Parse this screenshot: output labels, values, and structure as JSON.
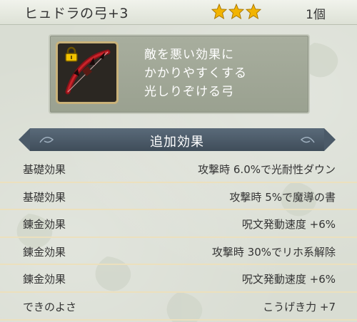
{
  "item": {
    "name": "ヒュドラの弓+3",
    "stars": 3,
    "count": "1個",
    "description": [
      "敵を悪い効果に",
      "かかりやすくする",
      "光しりぞける弓"
    ]
  },
  "section": {
    "title": "追加効果"
  },
  "effects": [
    {
      "label": "基礎効果",
      "value": "攻撃時 6.0%で光耐性ダウン"
    },
    {
      "label": "基礎効果",
      "value": "攻撃時 5%で魔導の書"
    },
    {
      "label": "錬金効果",
      "value": "呪文発動速度 +6%"
    },
    {
      "label": "錬金効果",
      "value": "攻撃時 30%でリホ系解除"
    },
    {
      "label": "錬金効果",
      "value": "呪文発動速度 +6%"
    },
    {
      "label": "できのよさ",
      "value": "こうげき力 +7"
    }
  ],
  "colors": {
    "star": "#f2b400",
    "header": "#4b5a68",
    "divider": "#ece0bd"
  },
  "icons": {
    "item": "bow-icon",
    "lock": "lock-icon",
    "star": "star-icon"
  }
}
